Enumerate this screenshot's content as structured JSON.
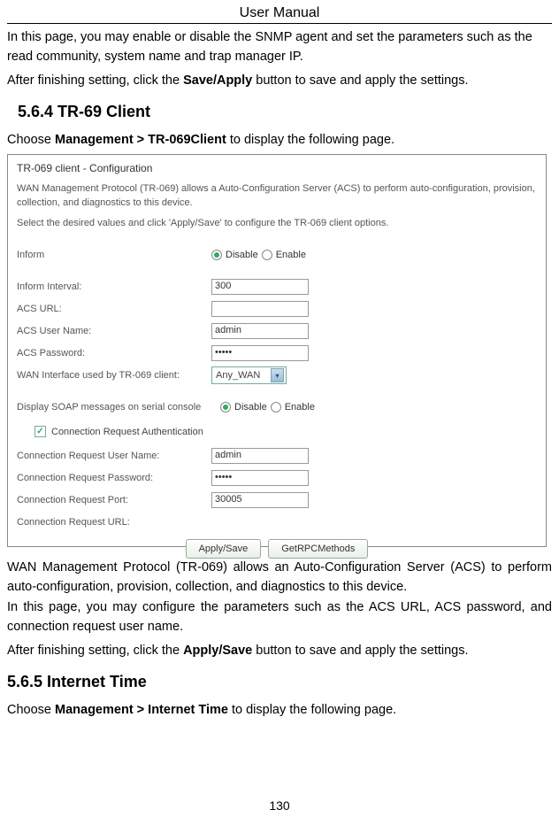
{
  "header": {
    "title": "User Manual"
  },
  "intro": {
    "p1": "In this page, you may enable or disable the SNMP agent and set the parameters such as the read community, system name and trap manager IP.",
    "p2_pre": "After finishing setting, click the ",
    "p2_bold": "Save/Apply",
    "p2_post": " button to save and apply the settings."
  },
  "section1": {
    "heading": "5.6.4   TR-69 Client",
    "nav_pre": "Choose ",
    "nav_bold": "Management > TR-069Client",
    "nav_post": " to display the following page."
  },
  "screenshot": {
    "title": "TR-069 client - Configuration",
    "desc1": "WAN Management Protocol (TR-069) allows a Auto-Configuration Server (ACS) to perform auto-configuration, provision, collection, and diagnostics to this device.",
    "desc2": "Select the desired values and click 'Apply/Save' to configure the TR-069 client options.",
    "inform_label": "Inform",
    "disable_label": "Disable",
    "enable_label": "Enable",
    "interval_label": "Inform Interval:",
    "interval_value": "300",
    "acs_url_label": "ACS URL:",
    "acs_url_value": "",
    "acs_user_label": "ACS User Name:",
    "acs_user_value": "admin",
    "acs_pass_label": "ACS Password:",
    "acs_pass_value": "•••••",
    "wan_iface_label": "WAN Interface used by TR-069 client:",
    "wan_iface_value": "Any_WAN",
    "soap_label": "Display SOAP messages on serial console",
    "auth_check_label": "Connection Request Authentication",
    "cr_user_label": "Connection Request User Name:",
    "cr_user_value": "admin",
    "cr_pass_label": "Connection Request Password:",
    "cr_pass_value": "•••••",
    "cr_port_label": "Connection Request Port:",
    "cr_port_value": "30005",
    "cr_url_label": "Connection Request URL:",
    "cr_url_value": "",
    "btn_apply": "Apply/Save",
    "btn_rpc": "GetRPCMethods"
  },
  "body2": {
    "p1": "WAN Management Protocol (TR-069) allows an Auto-Configuration Server (ACS) to perform auto-configuration, provision, collection, and diagnostics to this device.",
    "p2": "In this page, you may configure the parameters such as the ACS URL, ACS password, and connection request user name.",
    "p3_pre": "After finishing setting, click the ",
    "p3_bold": "Apply/Save",
    "p3_post": " button to save and apply the settings."
  },
  "section2": {
    "heading": "5.6.5  Internet Time",
    "nav_pre": "Choose ",
    "nav_bold": "Management > Internet Time",
    "nav_post": " to display the following page."
  },
  "page_number": "130"
}
